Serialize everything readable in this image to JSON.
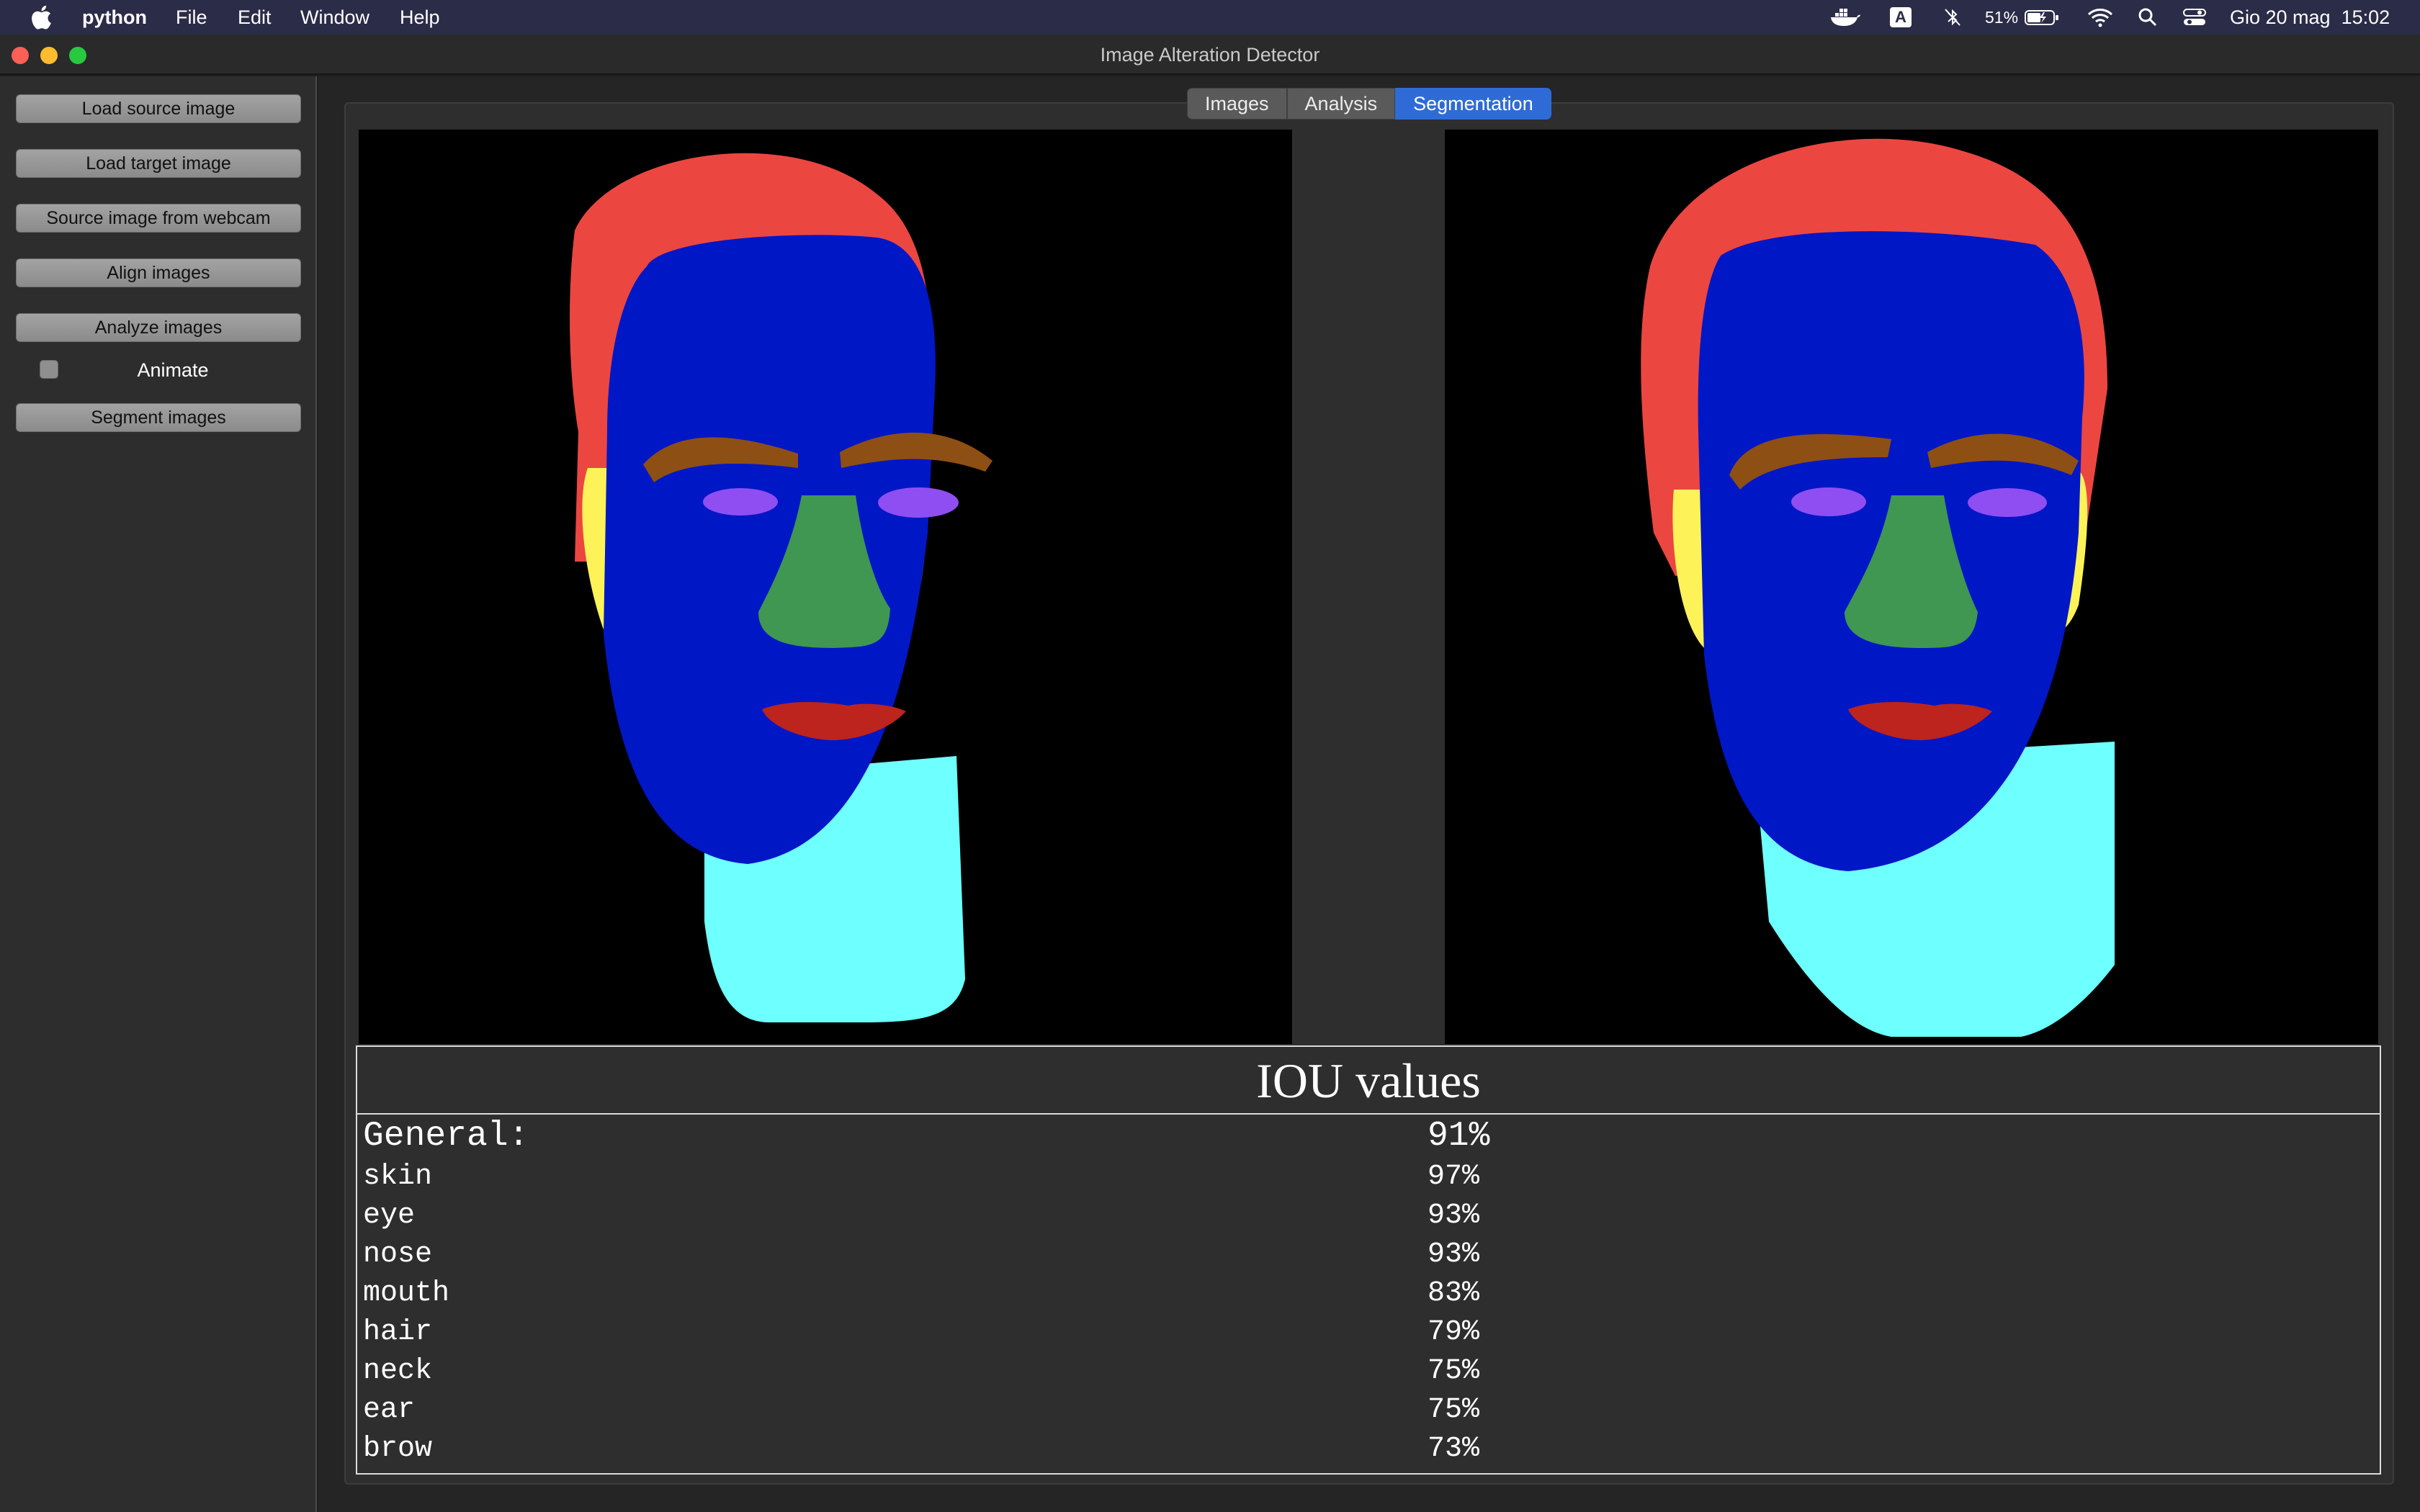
{
  "menubar": {
    "app_name": "python",
    "items": [
      "File",
      "Edit",
      "Window",
      "Help"
    ],
    "input_indicator": "A",
    "battery": "51%",
    "clock": "Gio 20 mag  15:02"
  },
  "window": {
    "title": "Image Alteration Detector"
  },
  "sidebar": {
    "buttons": {
      "load_source": "Load source image",
      "load_target": "Load target image",
      "webcam": "Source image from webcam",
      "align": "Align images",
      "analyze": "Analyze images",
      "segment": "Segment images"
    },
    "animate_label": "Animate",
    "animate_checked": false
  },
  "tabs": [
    "Images",
    "Analysis",
    "Segmentation"
  ],
  "active_tab": "Segmentation",
  "segmentation_colors": {
    "background": "#000000",
    "hair": "#ec4641",
    "skin": "#0017c6",
    "brow": "#8e4f14",
    "eye": "#8f4ef2",
    "nose": "#3f9752",
    "mouth": "#bc241d",
    "ear": "#fdf358",
    "neck": "#6effff"
  },
  "iou": {
    "title": "IOU values",
    "general": {
      "label": "General:",
      "value": "91%"
    },
    "rows": [
      {
        "label": "skin",
        "value": "97%"
      },
      {
        "label": "eye",
        "value": "93%"
      },
      {
        "label": "nose",
        "value": "93%"
      },
      {
        "label": "mouth",
        "value": "83%"
      },
      {
        "label": "hair",
        "value": "79%"
      },
      {
        "label": "neck",
        "value": "75%"
      },
      {
        "label": "ear",
        "value": "75%"
      },
      {
        "label": "brow",
        "value": "73%"
      }
    ]
  }
}
